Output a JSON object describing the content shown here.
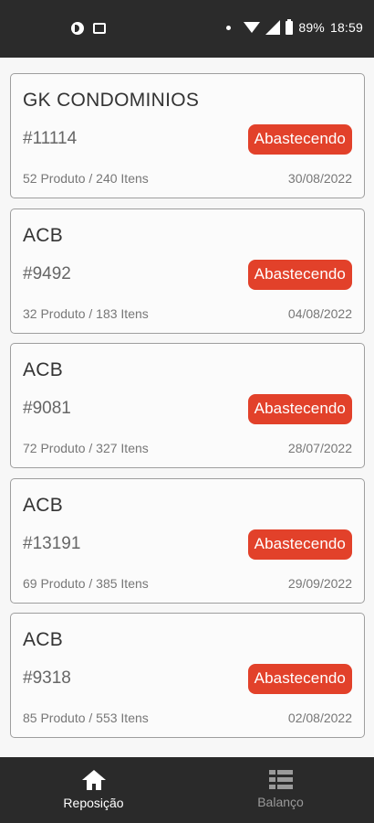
{
  "status_bar": {
    "battery": "89%",
    "time": "18:59"
  },
  "orders": [
    {
      "title": "GK CONDOMINIOS",
      "id": "#11114",
      "status": "Abastecendo",
      "count": "52 Produto / 240 Itens",
      "date": "30/08/2022"
    },
    {
      "title": "ACB",
      "id": "#9492",
      "status": "Abastecendo",
      "count": "32 Produto / 183 Itens",
      "date": "04/08/2022"
    },
    {
      "title": "ACB",
      "id": "#9081",
      "status": "Abastecendo",
      "count": "72 Produto / 327 Itens",
      "date": "28/07/2022"
    },
    {
      "title": "ACB",
      "id": "#13191",
      "status": "Abastecendo",
      "count": "69 Produto / 385 Itens",
      "date": "29/09/2022"
    },
    {
      "title": "ACB",
      "id": "#9318",
      "status": "Abastecendo",
      "count": "85 Produto / 553 Itens",
      "date": "02/08/2022"
    }
  ],
  "bottom_nav": {
    "items": [
      {
        "label": "Reposição",
        "icon": "home-icon",
        "active": true
      },
      {
        "label": "Balanço",
        "icon": "list-icon",
        "active": false
      }
    ]
  },
  "colors": {
    "badge": "#e2412a",
    "bars": "#2b2b2b"
  }
}
